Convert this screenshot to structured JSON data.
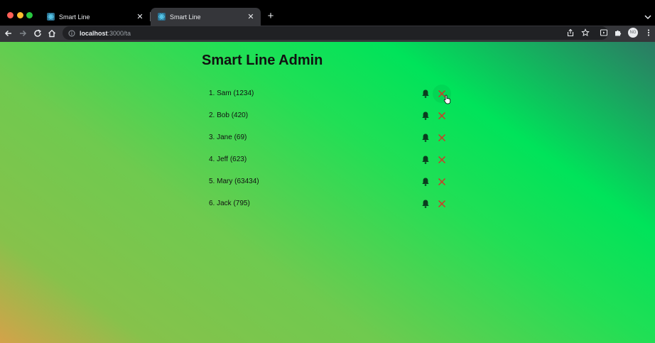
{
  "browser": {
    "tabs": [
      {
        "title": "Smart Line",
        "active": false
      },
      {
        "title": "Smart Line",
        "active": true
      }
    ],
    "address": {
      "host": "localhost",
      "path": ":3000/ta"
    },
    "profile_initials": "NG"
  },
  "page": {
    "title": "Smart Line Admin",
    "queue": [
      {
        "label": "1. Sam (1234)"
      },
      {
        "label": "2. Bob (420)"
      },
      {
        "label": "3. Jane (69)"
      },
      {
        "label": "4. Jeff (623)"
      },
      {
        "label": "5. Mary (63434)"
      },
      {
        "label": "6. Jack (795)"
      }
    ]
  },
  "colors": {
    "remove_icon": "#d93025",
    "bell_icon": "#0b3d1f",
    "accent_green": "#00e35a"
  },
  "icons": {
    "notify": "bell-icon",
    "remove": "close-icon"
  }
}
